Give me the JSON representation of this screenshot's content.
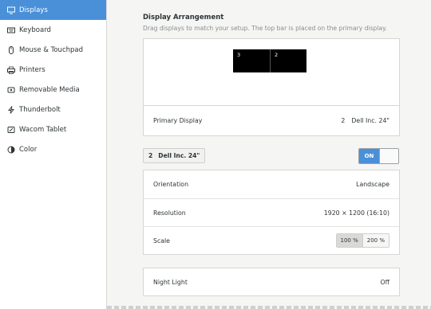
{
  "sidebar": {
    "items": [
      {
        "label": "Displays",
        "icon": "display-icon",
        "active": true
      },
      {
        "label": "Keyboard",
        "icon": "keyboard-icon"
      },
      {
        "label": "Mouse & Touchpad",
        "icon": "mouse-icon"
      },
      {
        "label": "Printers",
        "icon": "printer-icon"
      },
      {
        "label": "Removable Media",
        "icon": "media-icon"
      },
      {
        "label": "Thunderbolt",
        "icon": "thunderbolt-icon"
      },
      {
        "label": "Wacom Tablet",
        "icon": "tablet-icon"
      },
      {
        "label": "Color",
        "icon": "color-icon"
      }
    ]
  },
  "arrangement": {
    "title": "Display Arrangement",
    "subtitle": "Drag displays to match your setup. The top bar is placed on the primary display.",
    "monitors": [
      "3",
      "2"
    ]
  },
  "primary": {
    "label": "Primary Display",
    "number": "2",
    "name": "Dell Inc. 24\""
  },
  "selected_monitor": {
    "number": "2",
    "name": "Dell Inc. 24\"",
    "toggle_label": "ON"
  },
  "settings": {
    "orientation_label": "Orientation",
    "orientation_value": "Landscape",
    "resolution_label": "Resolution",
    "resolution_value": "1920 × 1200 (16:10)",
    "scale_label": "Scale",
    "scale_options": [
      "100 %",
      "200 %"
    ]
  },
  "night_light": {
    "label": "Night Light",
    "value": "Off"
  },
  "colors": {
    "accent": "#4a90d9"
  }
}
